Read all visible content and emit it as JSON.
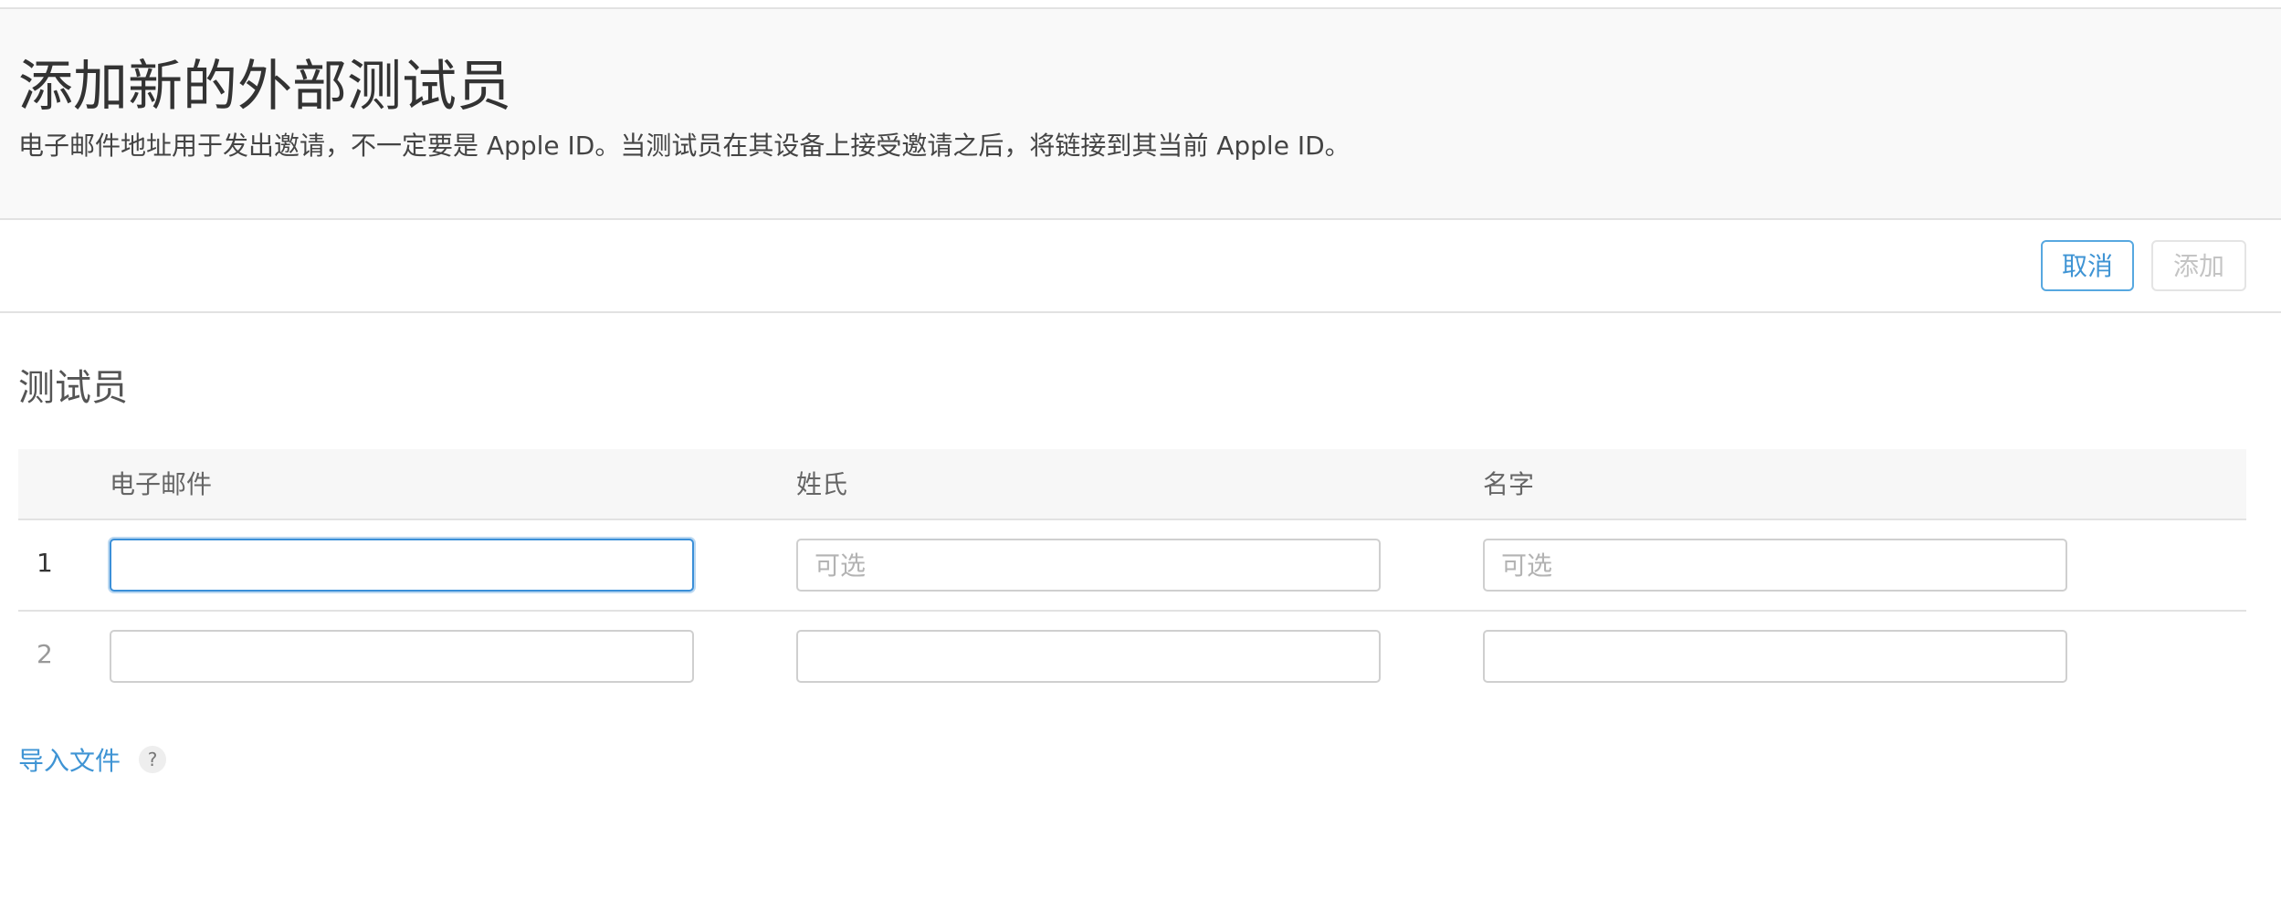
{
  "header": {
    "title": "添加新的外部测试员",
    "subtitle": "电子邮件地址用于发出邀请，不一定要是 Apple ID。当测试员在其设备上接受邀请之后，将链接到其当前 Apple ID。"
  },
  "toolbar": {
    "cancel_label": "取消",
    "add_label": "添加"
  },
  "testers": {
    "section_title": "测试员",
    "columns": [
      "电子邮件",
      "姓氏",
      "名字"
    ],
    "rows": [
      {
        "number": "1",
        "email_value": "",
        "email_placeholder": "",
        "last_name_value": "",
        "last_name_placeholder": "可选",
        "first_name_value": "",
        "first_name_placeholder": "可选"
      },
      {
        "number": "2",
        "email_value": "",
        "email_placeholder": "",
        "last_name_value": "",
        "last_name_placeholder": "",
        "first_name_value": "",
        "first_name_placeholder": ""
      }
    ]
  },
  "import": {
    "label": "导入文件",
    "help_icon_glyph": "?"
  },
  "colors": {
    "accent": "#3f94d4",
    "focus_border": "#3b8fd8",
    "header_bg": "#f9f9f9"
  }
}
